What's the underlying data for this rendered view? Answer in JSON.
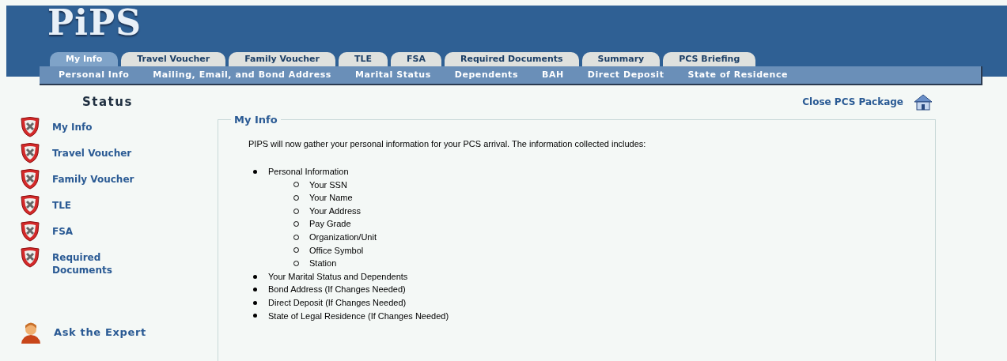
{
  "logo": "PiPS",
  "tabs": [
    {
      "label": "My Info",
      "selected": true
    },
    {
      "label": "Travel Voucher",
      "selected": false
    },
    {
      "label": "Family Voucher",
      "selected": false
    },
    {
      "label": "TLE",
      "selected": false
    },
    {
      "label": "FSA",
      "selected": false
    },
    {
      "label": "Required Documents",
      "selected": false
    },
    {
      "label": "Summary",
      "selected": false
    },
    {
      "label": "PCS Briefing",
      "selected": false
    }
  ],
  "subnav": [
    "Personal Info",
    "Mailing, Email, and Bond Address",
    "Marital Status",
    "Dependents",
    "BAH",
    "Direct Deposit",
    "State of Residence"
  ],
  "sidebar": {
    "title": "Status",
    "items": [
      {
        "label": "My Info",
        "complete": false
      },
      {
        "label": "Travel Voucher",
        "complete": false
      },
      {
        "label": "Family Voucher",
        "complete": false
      },
      {
        "label": "TLE",
        "complete": false
      },
      {
        "label": "FSA",
        "complete": false
      },
      {
        "label": "Required Documents",
        "complete": false
      }
    ],
    "expert_link": "Ask the Expert"
  },
  "close_link": "Close PCS Package",
  "panel": {
    "legend": "My Info",
    "intro": "PIPS will now gather your personal information for your PCS arrival. The information collected includes:",
    "items": [
      {
        "label": "Personal Information",
        "children": [
          {
            "label": "Your SSN"
          },
          {
            "label": "Your Name"
          },
          {
            "label": "Your Address"
          },
          {
            "label": "Pay Grade"
          },
          {
            "label": "Organization/Unit"
          },
          {
            "label": "Office Symbol"
          },
          {
            "label": "Station"
          }
        ]
      },
      {
        "label": "Your Marital Status and Dependents"
      },
      {
        "label": "Bond Address (If Changes Needed)"
      },
      {
        "label": "Direct Deposit (If Changes Needed)"
      },
      {
        "label": "State of Legal Residence (If Changes Needed)"
      }
    ]
  }
}
